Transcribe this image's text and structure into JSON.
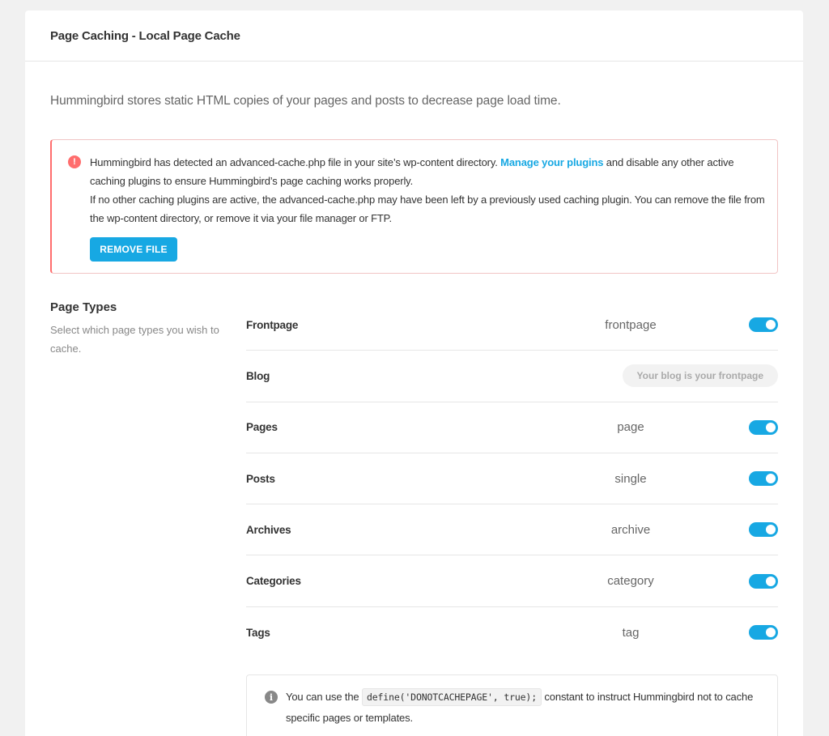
{
  "header": {
    "title": "Page Caching - Local Page Cache"
  },
  "intro": "Hummingbird stores static HTML copies of your pages and posts to decrease page load time.",
  "notice": {
    "icon": "error-icon",
    "icon_glyph": "!",
    "text_before": "Hummingbird has detected an advanced-cache.php file in your site’s wp-content directory. ",
    "link": "Manage your plugins",
    "text_after": " and disable any other active caching plugins to ensure Hummingbird’s page caching works properly.",
    "text_second": "If no other caching plugins are active, the advanced-cache.php may have been left by a previously used caching plugin. You can remove the file from the wp-content directory, or remove it via your file manager or FTP.",
    "button": "REMOVE FILE",
    "accent_color": "#ff6d6d"
  },
  "page_types": {
    "title": "Page Types",
    "description": "Select which page types you wish to cache.",
    "rows": [
      {
        "name": "Frontpage",
        "slug": "frontpage",
        "enabled": true
      },
      {
        "name": "Blog",
        "pill": "Your blog is your frontpage"
      },
      {
        "name": "Pages",
        "slug": "page",
        "enabled": true
      },
      {
        "name": "Posts",
        "slug": "single",
        "enabled": true
      },
      {
        "name": "Archives",
        "slug": "archive",
        "enabled": true
      },
      {
        "name": "Categories",
        "slug": "category",
        "enabled": true
      },
      {
        "name": "Tags",
        "slug": "tag",
        "enabled": true
      }
    ]
  },
  "info": {
    "icon": "info-icon",
    "icon_glyph": "i",
    "text_before": "You can use the ",
    "code": "define('DONOTCACHEPAGE', true);",
    "text_after": " constant to instruct Hummingbird not to cache specific pages or templates."
  },
  "colors": {
    "accent": "#17a8e3",
    "error": "#ff6d6d"
  }
}
